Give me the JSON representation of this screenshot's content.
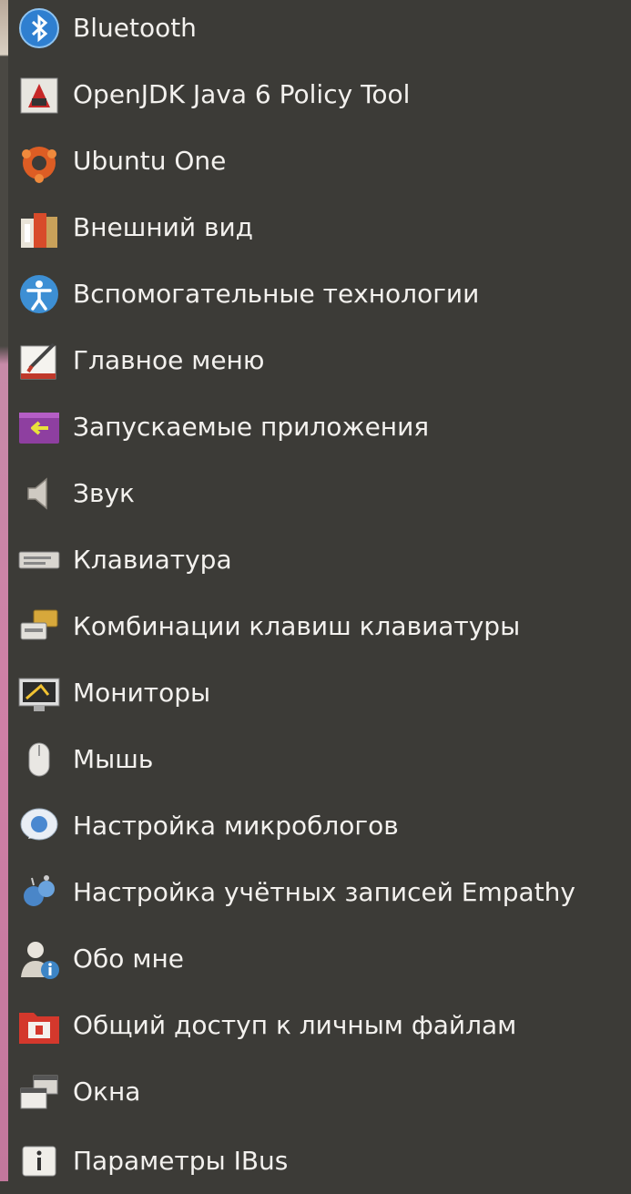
{
  "menu": {
    "items": [
      {
        "label": "Bluetooth",
        "icon": "bluetooth-icon"
      },
      {
        "label": "OpenJDK Java 6 Policy Tool",
        "icon": "java-policy-icon"
      },
      {
        "label": "Ubuntu One",
        "icon": "ubuntu-one-icon"
      },
      {
        "label": "Внешний вид",
        "icon": "appearance-icon"
      },
      {
        "label": "Вспомогательные технологии",
        "icon": "accessibility-icon"
      },
      {
        "label": "Главное меню",
        "icon": "main-menu-editor-icon"
      },
      {
        "label": "Запускаемые приложения",
        "icon": "startup-applications-icon"
      },
      {
        "label": "Звук",
        "icon": "sound-icon"
      },
      {
        "label": "Клавиатура",
        "icon": "keyboard-icon"
      },
      {
        "label": "Комбинации клавиш клавиатуры",
        "icon": "keyboard-shortcuts-icon"
      },
      {
        "label": "Мониторы",
        "icon": "monitor-icon"
      },
      {
        "label": "Мышь",
        "icon": "mouse-icon"
      },
      {
        "label": "Настройка микроблогов",
        "icon": "microblog-icon"
      },
      {
        "label": "Настройка учётных записей Empathy",
        "icon": "empathy-accounts-icon"
      },
      {
        "label": "Обо мне",
        "icon": "about-me-icon"
      },
      {
        "label": "Общий доступ к личным файлам",
        "icon": "file-sharing-icon"
      },
      {
        "label": "Окна",
        "icon": "windows-icon"
      },
      {
        "label": "Параметры IBus",
        "icon": "ibus-icon"
      }
    ]
  },
  "colors": {
    "background": "#3c3b37",
    "text": "#f3f1ee"
  }
}
